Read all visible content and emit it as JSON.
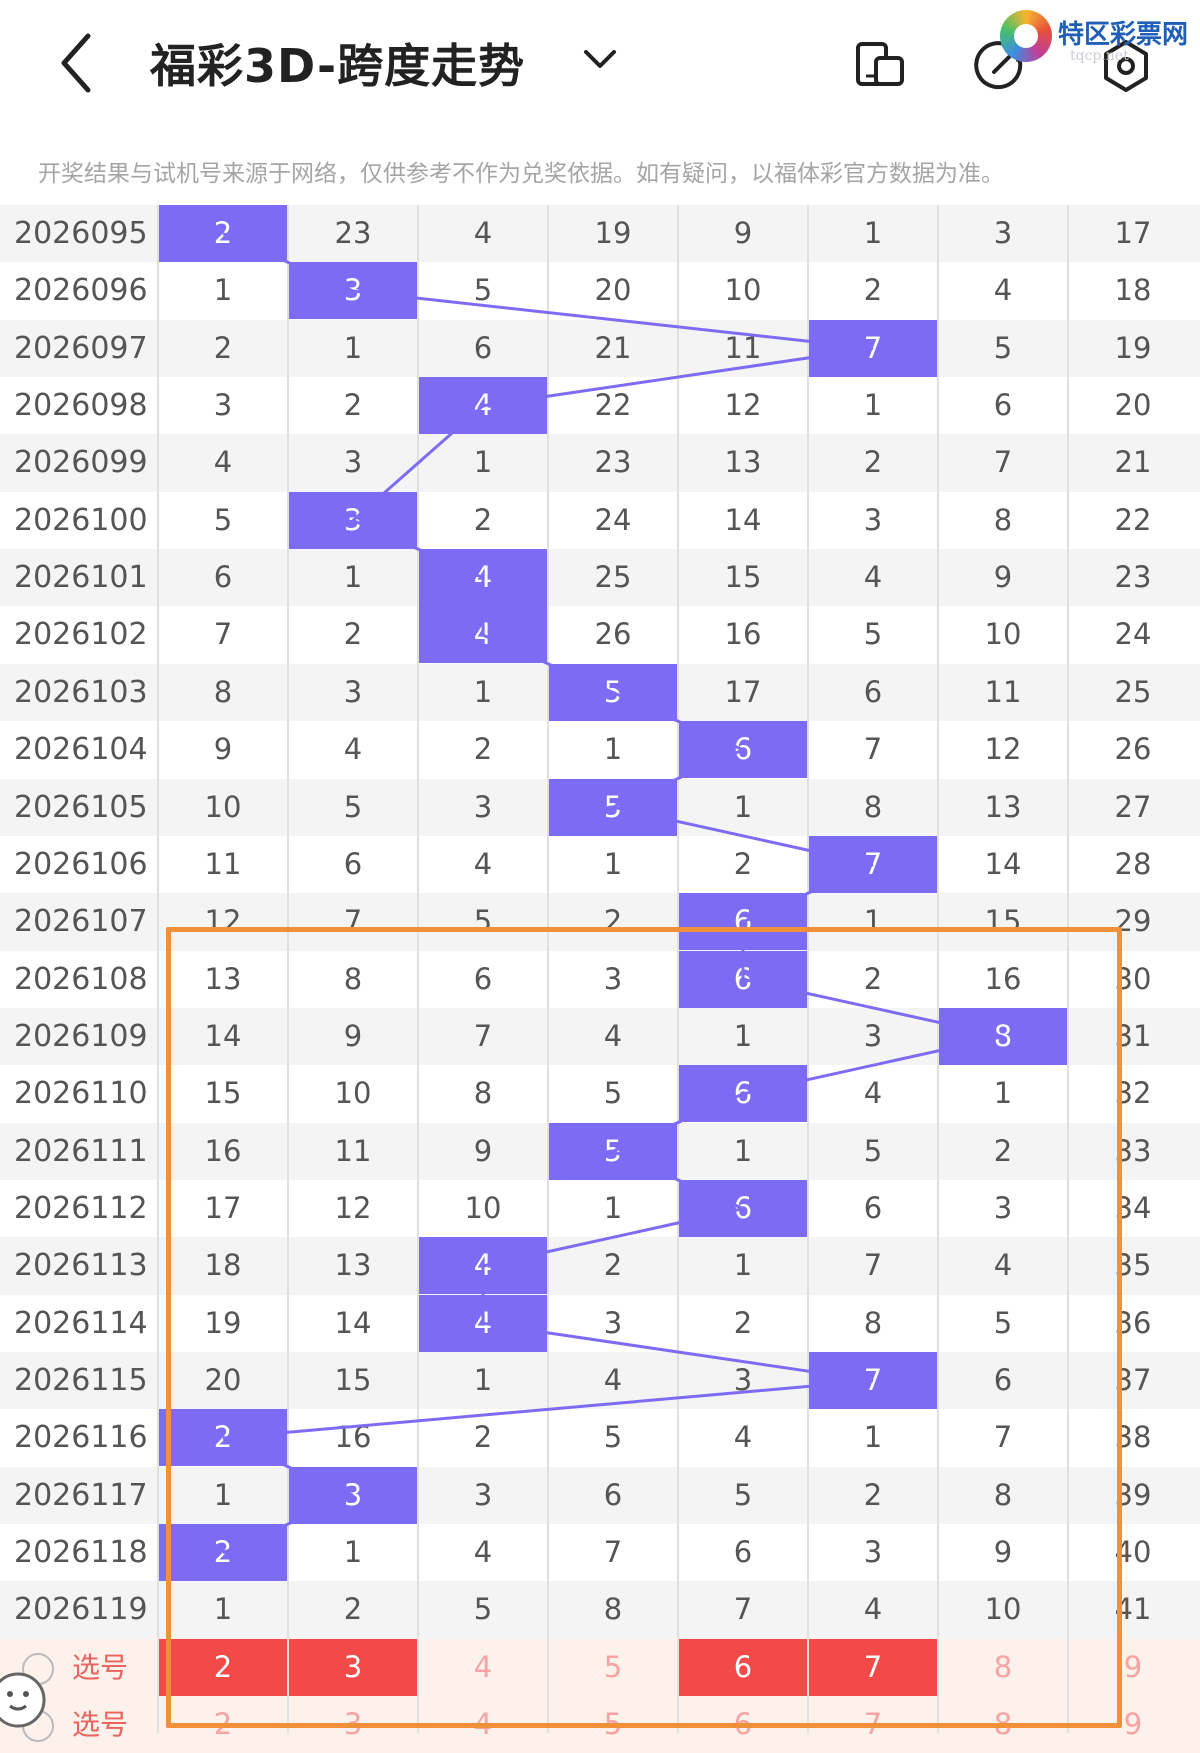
{
  "header": {
    "title": "福彩3D-跨度走势",
    "logo_text": "特区彩票网",
    "logo_sub": "tqcp.net"
  },
  "notice": "开奖结果与试机号来源于网络，仅供参考不作为兑奖依据。如有疑问，以福体彩官方数据为准。",
  "colors": {
    "hit": "#7d6cf3",
    "selected": "#f24949",
    "highlight_box": "#f0913a"
  },
  "icons": [
    "back-icon",
    "chevron-down-icon",
    "device-icon",
    "share-icon",
    "settings-icon",
    "logo-icon"
  ],
  "table": {
    "rows": [
      {
        "issue": "2026095",
        "values": [
          "2",
          "23",
          "4",
          "19",
          "9",
          "1",
          "3",
          "17"
        ],
        "hit": 0
      },
      {
        "issue": "2026096",
        "values": [
          "1",
          "3",
          "5",
          "20",
          "10",
          "2",
          "4",
          "18"
        ],
        "hit": 1
      },
      {
        "issue": "2026097",
        "values": [
          "2",
          "1",
          "6",
          "21",
          "11",
          "7",
          "5",
          "19"
        ],
        "hit": 5
      },
      {
        "issue": "2026098",
        "values": [
          "3",
          "2",
          "4",
          "22",
          "12",
          "1",
          "6",
          "20"
        ],
        "hit": 2
      },
      {
        "issue": "2026099",
        "values": [
          "4",
          "3",
          "1",
          "23",
          "13",
          "2",
          "7",
          "21"
        ],
        "hit": -1
      },
      {
        "issue": "2026100",
        "values": [
          "5",
          "3",
          "2",
          "24",
          "14",
          "3",
          "8",
          "22"
        ],
        "hit": 1
      },
      {
        "issue": "2026101",
        "values": [
          "6",
          "1",
          "4",
          "25",
          "15",
          "4",
          "9",
          "23"
        ],
        "hit": 2
      },
      {
        "issue": "2026102",
        "values": [
          "7",
          "2",
          "4",
          "26",
          "16",
          "5",
          "10",
          "24"
        ],
        "hit": 2
      },
      {
        "issue": "2026103",
        "values": [
          "8",
          "3",
          "1",
          "5",
          "17",
          "6",
          "11",
          "25"
        ],
        "hit": 3
      },
      {
        "issue": "2026104",
        "values": [
          "9",
          "4",
          "2",
          "1",
          "6",
          "7",
          "12",
          "26"
        ],
        "hit": 4
      },
      {
        "issue": "2026105",
        "values": [
          "10",
          "5",
          "3",
          "5",
          "1",
          "8",
          "13",
          "27"
        ],
        "hit": 3
      },
      {
        "issue": "2026106",
        "values": [
          "11",
          "6",
          "4",
          "1",
          "2",
          "7",
          "14",
          "28"
        ],
        "hit": 5
      },
      {
        "issue": "2026107",
        "values": [
          "12",
          "7",
          "5",
          "2",
          "6",
          "1",
          "15",
          "29"
        ],
        "hit": 4
      },
      {
        "issue": "2026108",
        "values": [
          "13",
          "8",
          "6",
          "3",
          "6",
          "2",
          "16",
          "30"
        ],
        "hit": 4
      },
      {
        "issue": "2026109",
        "values": [
          "14",
          "9",
          "7",
          "4",
          "1",
          "3",
          "8",
          "31"
        ],
        "hit": 6
      },
      {
        "issue": "2026110",
        "values": [
          "15",
          "10",
          "8",
          "5",
          "6",
          "4",
          "1",
          "32"
        ],
        "hit": 4
      },
      {
        "issue": "2026111",
        "values": [
          "16",
          "11",
          "9",
          "5",
          "1",
          "5",
          "2",
          "33"
        ],
        "hit": 3
      },
      {
        "issue": "2026112",
        "values": [
          "17",
          "12",
          "10",
          "1",
          "6",
          "6",
          "3",
          "34"
        ],
        "hit": 4
      },
      {
        "issue": "2026113",
        "values": [
          "18",
          "13",
          "4",
          "2",
          "1",
          "7",
          "4",
          "35"
        ],
        "hit": 2
      },
      {
        "issue": "2026114",
        "values": [
          "19",
          "14",
          "4",
          "3",
          "2",
          "8",
          "5",
          "36"
        ],
        "hit": 2
      },
      {
        "issue": "2026115",
        "values": [
          "20",
          "15",
          "1",
          "4",
          "3",
          "7",
          "6",
          "37"
        ],
        "hit": 5
      },
      {
        "issue": "2026116",
        "values": [
          "2",
          "16",
          "2",
          "5",
          "4",
          "1",
          "7",
          "38"
        ],
        "hit": 0
      },
      {
        "issue": "2026117",
        "values": [
          "1",
          "3",
          "3",
          "6",
          "5",
          "2",
          "8",
          "39"
        ],
        "hit": 1
      },
      {
        "issue": "2026118",
        "values": [
          "2",
          "1",
          "4",
          "7",
          "6",
          "3",
          "9",
          "40"
        ],
        "hit": 0
      },
      {
        "issue": "2026119",
        "values": [
          "1",
          "2",
          "5",
          "8",
          "7",
          "4",
          "10",
          "41"
        ],
        "hit": -1
      }
    ],
    "select_rows": [
      {
        "label": "选号",
        "values": [
          "2",
          "3",
          "4",
          "5",
          "6",
          "7",
          "8",
          "9"
        ],
        "selected": [
          0,
          1,
          4,
          5
        ]
      },
      {
        "label": "选号",
        "values": [
          "2",
          "3",
          "4",
          "5",
          "6",
          "7",
          "8",
          "9"
        ],
        "selected": []
      }
    ]
  }
}
